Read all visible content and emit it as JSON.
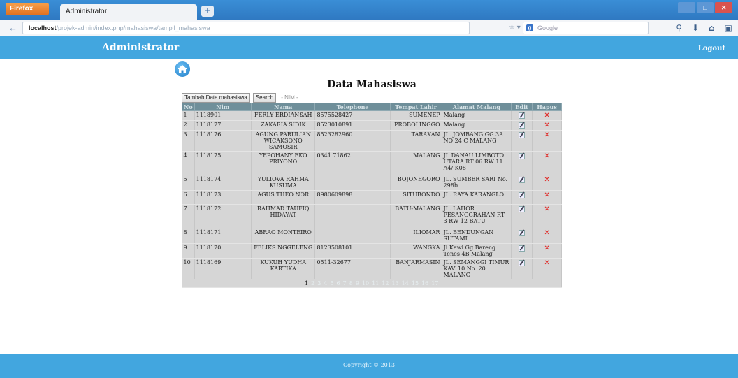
{
  "browser": {
    "app_button": "Firefox",
    "tab_title": "Administrator",
    "url_host": "localhost",
    "url_path": "/projek-admin/index.php/mahasiswa/tampil_mahasiswa",
    "search_placeholder": "Google"
  },
  "header": {
    "title": "Administrator",
    "logout_label": "Logout"
  },
  "main": {
    "heading": "Data Mahasiswa",
    "add_button": "Tambah Data mahasiswa",
    "search_button": "Search",
    "nim_placeholder": "- NIM -",
    "columns": [
      "No",
      "Nim",
      "Nama",
      "Telephone",
      "Tempat Lahir",
      "Alamat Malang",
      "Edit",
      "Hapus"
    ],
    "rows": [
      {
        "no": "1",
        "nim": "1118901",
        "nama": "FERLY ERDIANSAH",
        "telp": "8575528427",
        "tempat": "SUMENEP",
        "alamat": "Malang"
      },
      {
        "no": "2",
        "nim": "1118177",
        "nama": "ZAKARIA SIDIK",
        "telp": "8523010891",
        "tempat": "PROBOLINGGO",
        "alamat": "Malang"
      },
      {
        "no": "3",
        "nim": "1118176",
        "nama": "AGUNG PARULIAN WICAKSONO SAMOSIR",
        "telp": "8523282960",
        "tempat": "TARAKAN",
        "alamat": "JL. JOMBANG GG 3A NO 24 C MALANG"
      },
      {
        "no": "4",
        "nim": "1118175",
        "nama": "YEPOHANY EKO PRIYONO",
        "telp": "0341 71862",
        "tempat": "MALANG",
        "alamat": "JL DANAU LIMBOTO UTARA RT 06 RW 11 A4/ K08"
      },
      {
        "no": "5",
        "nim": "1118174",
        "nama": "YULIOVA RAHMA KUSUMA",
        "telp": "",
        "tempat": "BOJONEGORO",
        "alamat": "JL. SUMBER SARI No. 298b"
      },
      {
        "no": "6",
        "nim": "1118173",
        "nama": "AGUS THEO NOR",
        "telp": "8980609898",
        "tempat": "SITUBONDO",
        "alamat": "JL. RAYA KARANGLO"
      },
      {
        "no": "7",
        "nim": "1118172",
        "nama": "RAHMAD TAUFIQ HIDAYAT",
        "telp": "",
        "tempat": "BATU-MALANG",
        "alamat": "JL. LAHOR PESANGGRAHAN RT 3 RW 12 BATU"
      },
      {
        "no": "8",
        "nim": "1118171",
        "nama": "ABRAO MONTEIRO",
        "telp": "",
        "tempat": "ILIOMAR",
        "alamat": "JL. BENDUNGAN SUTAMI"
      },
      {
        "no": "9",
        "nim": "1118170",
        "nama": "FELIKS NGGELENG",
        "telp": "8123508101",
        "tempat": "WANGKA",
        "alamat": "Jl Kawi Gg Bareng Tenes 4B Malang"
      },
      {
        "no": "10",
        "nim": "1118169",
        "nama": "KUKUH YUDHA KARTIKA",
        "telp": "0511-32677",
        "tempat": "BANJARMASIN",
        "alamat": "JL. SEMANGGI TIMUR KAV. 10 No. 20 MALANG"
      }
    ],
    "pages": [
      "1",
      "2",
      "3",
      "4",
      "5",
      "6",
      "7",
      "8",
      "9",
      "10",
      "11",
      "12",
      "13",
      "14",
      "15",
      "16",
      "17"
    ],
    "current_page": "1"
  },
  "footer": {
    "text": "Copyright © 2013"
  },
  "colors": {
    "header_bg": "#42a6df",
    "table_header_bg": "#6f8f9a",
    "row_bg": "#d6d6d6",
    "delete": "#e0221f"
  }
}
